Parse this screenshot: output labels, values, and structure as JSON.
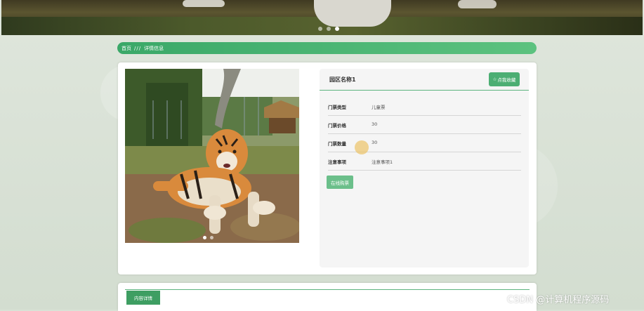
{
  "banner": {
    "slides": 3,
    "active_slide": 3
  },
  "breadcrumb": {
    "home": "首页",
    "separator": "///",
    "current": "详情信息"
  },
  "photo": {
    "slides": 2,
    "active_slide": 1
  },
  "detail": {
    "title": "园区名称1",
    "favorite_label": "点我收藏",
    "fields": [
      {
        "label": "门票类型",
        "value": "儿童票"
      },
      {
        "label": "门票价格",
        "value": "30"
      },
      {
        "label": "门票数量",
        "value": "30"
      },
      {
        "label": "注意事项",
        "value": "注意事项1"
      }
    ],
    "buy_label": "在线购票"
  },
  "content_tab": {
    "label": "内容详情"
  },
  "watermark": "CSDN @计算机程序源码",
  "colors": {
    "accent": "#3aa868",
    "button": "#4cae73"
  }
}
